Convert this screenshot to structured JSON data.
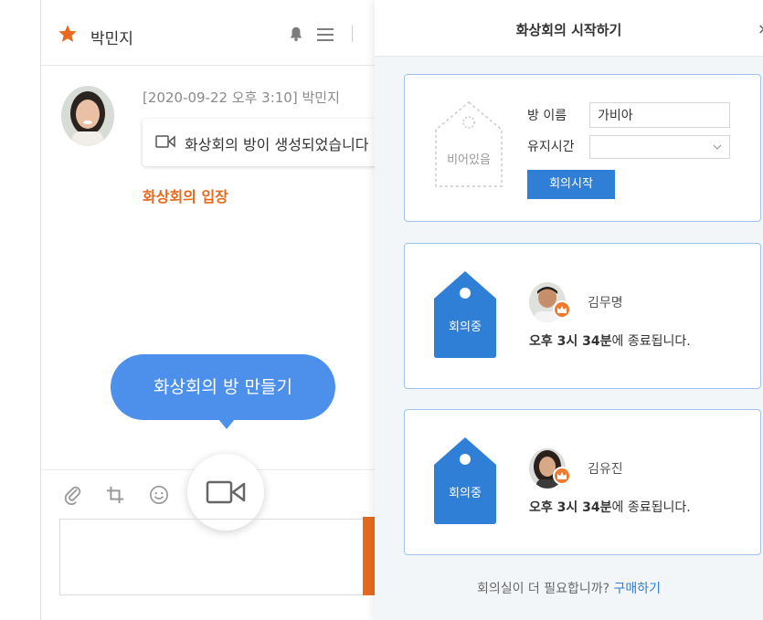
{
  "chat": {
    "title": "박민지",
    "message": {
      "meta": "[2020-09-22 오후 3:10] 박민지",
      "text": "화상회의 방이 생성되었습니다",
      "join_link": "화상회의 입장"
    },
    "tooltip": "화상회의 방 만들기",
    "accent_color": "#e8691e"
  },
  "meeting": {
    "title": "화상회의 시작하기",
    "close_glyph": "×",
    "new_room": {
      "empty_tag": "비어있음",
      "room_name_label": "방 이름",
      "room_name_value": "가비아",
      "duration_label": "유지시간",
      "duration_value": "",
      "start_button": "회의시작"
    },
    "active_rooms": [
      {
        "tag": "회의중",
        "host": "김무명",
        "end_prefix": "오후 3시 34분",
        "end_suffix": "에 종료됩니다."
      },
      {
        "tag": "회의중",
        "host": "김유진",
        "end_prefix": "오후 3시 34분",
        "end_suffix": "에 종료됩니다."
      }
    ],
    "footer_text": "회의실이 더 필요합니까?",
    "footer_link": "구매하기",
    "brand_color": "#2f7fd6"
  }
}
